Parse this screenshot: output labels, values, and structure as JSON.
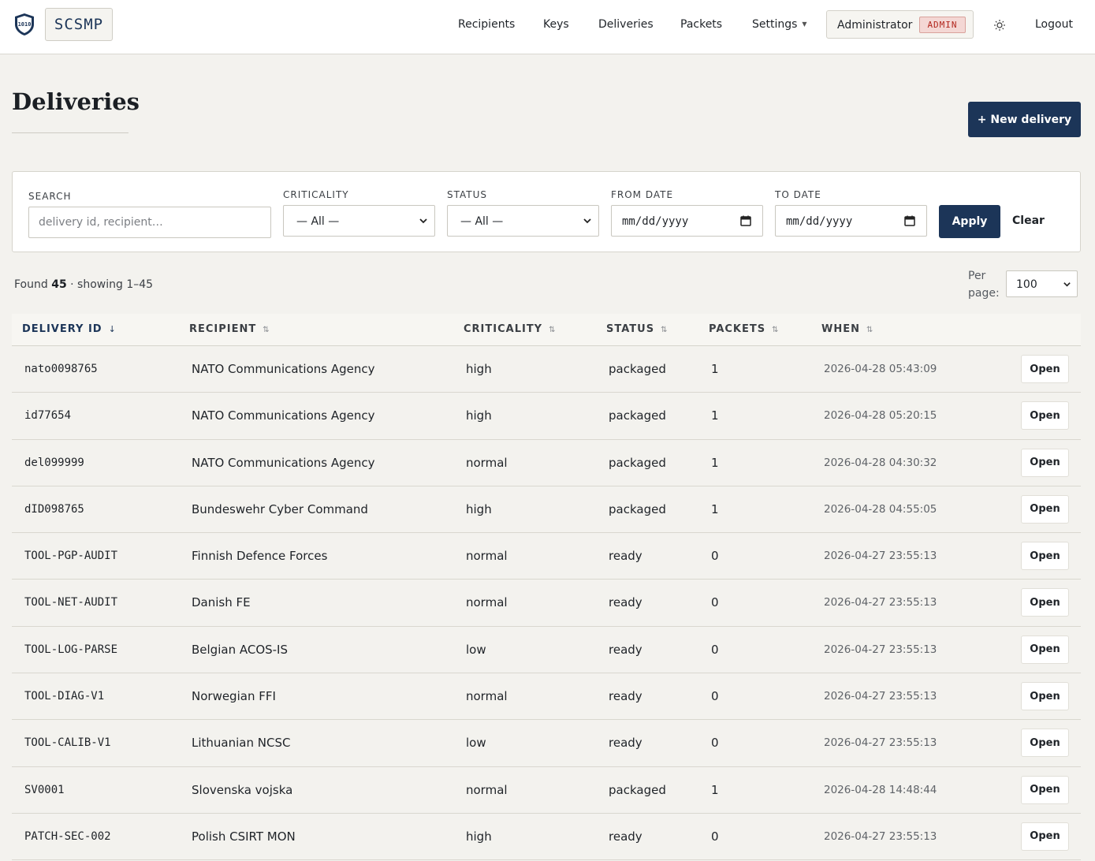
{
  "app": {
    "brand": "SCSMP"
  },
  "nav": {
    "items": [
      "Recipients",
      "Keys",
      "Deliveries",
      "Packets",
      "Settings"
    ],
    "user_name": "Administrator",
    "role_badge": "ADMIN",
    "logout": "Logout",
    "icons": {
      "logo": "shield-binary-icon",
      "settings_caret": "caret-down-icon",
      "theme": "sun-icon"
    }
  },
  "page": {
    "title": "Deliveries",
    "new_button": "+ New delivery"
  },
  "filters": {
    "search_label": "SEARCH",
    "search_placeholder": "delivery id, recipient…",
    "search_value": "",
    "criticality_label": "CRITICALITY",
    "criticality_value": "— All —",
    "status_label": "STATUS",
    "status_value": "— All —",
    "from_label": "FROM DATE",
    "from_value": "mm/dd/yyyy",
    "to_label": "TO DATE",
    "to_value": "mm/dd/yyyy",
    "apply": "Apply",
    "clear": "Clear"
  },
  "results": {
    "found_prefix": "Found",
    "found_count": "45",
    "showing": "· showing 1–45",
    "per_page_label": "Per page:",
    "per_page_value": "100"
  },
  "table": {
    "columns": [
      "DELIVERY ID",
      "RECIPIENT",
      "CRITICALITY",
      "STATUS",
      "PACKETS",
      "WHEN"
    ],
    "sort_active": "↓",
    "sort_inactive": "⇅",
    "open_label": "Open",
    "rows": [
      {
        "id": "nato0098765",
        "recipient": "NATO Communications Agency",
        "criticality": "high",
        "status": "packaged",
        "packets": "1",
        "when": "2026-04-28 05:43:09"
      },
      {
        "id": "id77654",
        "recipient": "NATO Communications Agency",
        "criticality": "high",
        "status": "packaged",
        "packets": "1",
        "when": "2026-04-28 05:20:15"
      },
      {
        "id": "del099999",
        "recipient": "NATO Communications Agency",
        "criticality": "normal",
        "status": "packaged",
        "packets": "1",
        "when": "2026-04-28 04:30:32"
      },
      {
        "id": "dID098765",
        "recipient": "Bundeswehr Cyber Command",
        "criticality": "high",
        "status": "packaged",
        "packets": "1",
        "when": "2026-04-28 04:55:05"
      },
      {
        "id": "TOOL-PGP-AUDIT",
        "recipient": "Finnish Defence Forces",
        "criticality": "normal",
        "status": "ready",
        "packets": "0",
        "when": "2026-04-27 23:55:13"
      },
      {
        "id": "TOOL-NET-AUDIT",
        "recipient": "Danish FE",
        "criticality": "normal",
        "status": "ready",
        "packets": "0",
        "when": "2026-04-27 23:55:13"
      },
      {
        "id": "TOOL-LOG-PARSE",
        "recipient": "Belgian ACOS-IS",
        "criticality": "low",
        "status": "ready",
        "packets": "0",
        "when": "2026-04-27 23:55:13"
      },
      {
        "id": "TOOL-DIAG-V1",
        "recipient": "Norwegian FFI",
        "criticality": "normal",
        "status": "ready",
        "packets": "0",
        "when": "2026-04-27 23:55:13"
      },
      {
        "id": "TOOL-CALIB-V1",
        "recipient": "Lithuanian NCSC",
        "criticality": "low",
        "status": "ready",
        "packets": "0",
        "when": "2026-04-27 23:55:13"
      },
      {
        "id": "SV0001",
        "recipient": "Slovenska vojska",
        "criticality": "normal",
        "status": "packaged",
        "packets": "1",
        "when": "2026-04-28 14:48:44"
      },
      {
        "id": "PATCH-SEC-002",
        "recipient": "Polish CSIRT MON",
        "criticality": "high",
        "status": "ready",
        "packets": "0",
        "when": "2026-04-27 23:55:13"
      }
    ]
  },
  "colors": {
    "primary": "#1c3558",
    "badge_bg": "#f4d7d4",
    "badge_text": "#b2261d",
    "page_bg": "#f3f2ee"
  }
}
